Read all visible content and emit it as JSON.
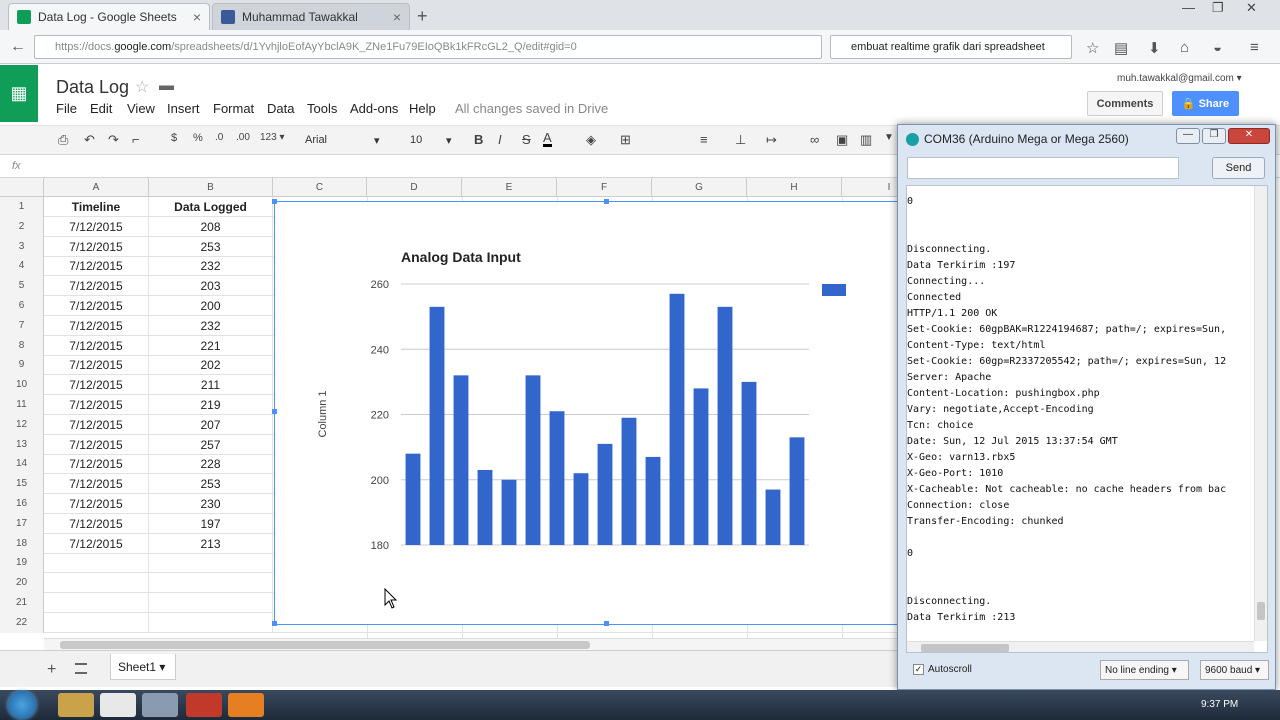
{
  "browser": {
    "tabs": [
      {
        "title": "Data Log - Google Sheets",
        "active": true,
        "favicon_color": "#0f9d58"
      },
      {
        "title": "Muhammad Tawakkal",
        "active": false,
        "favicon_color": "#3b5998"
      }
    ],
    "new_tab_label": "+",
    "url_prefix": "https://docs.",
    "url_host": "google.com",
    "url_path": "/spreadsheets/d/1YvhjloEofAyYbclA9K_ZNe1Fu79EIoQBk1kFRcGL2_Q/edit#gid=0",
    "search_text": "embuat realtime grafik dari spreadsheet",
    "win_minimize": "—",
    "win_restore": "❐",
    "win_close": "✕"
  },
  "sheets": {
    "doc_title": "Data Log",
    "star_icon": "☆",
    "folder_icon": "▬",
    "menu": [
      "File",
      "Edit",
      "View",
      "Insert",
      "Format",
      "Data",
      "Tools",
      "Add-ons",
      "Help"
    ],
    "save_status": "All changes saved in Drive",
    "user_email": "muh.tawakkal@gmail.com ▾",
    "comments_label": "Comments",
    "share_label": "🔒 Share",
    "fx_label": "fx",
    "toolbar": {
      "print": "⎙",
      "undo": "↶",
      "redo": "↷",
      "paint_format": "⌐",
      "currency": "$",
      "percent": "%",
      "dec_decrease": ".0",
      "dec_increase": ".00",
      "more_formats": "123 ▾",
      "font": "Arial",
      "font_arrow": "▾",
      "font_size": "10",
      "size_arrow": "▾",
      "bold": "B",
      "italic": "I",
      "strike": "S",
      "text_color": "A",
      "fill_color": "◈",
      "borders": "⊞",
      "align": "≡",
      "valign": "⊥",
      "wrap": "↦",
      "link": "∞",
      "comment": "▣",
      "chart": "▥",
      "filter": "▼"
    }
  },
  "grid": {
    "columns": [
      "A",
      "B",
      "C",
      "D",
      "E",
      "F",
      "G",
      "H",
      "I"
    ],
    "header_row": {
      "A": "Timeline",
      "B": "Data Logged"
    },
    "rows": [
      {
        "A": "7/12/2015",
        "B": "208"
      },
      {
        "A": "7/12/2015",
        "B": "253"
      },
      {
        "A": "7/12/2015",
        "B": "232"
      },
      {
        "A": "7/12/2015",
        "B": "203"
      },
      {
        "A": "7/12/2015",
        "B": "200"
      },
      {
        "A": "7/12/2015",
        "B": "232"
      },
      {
        "A": "7/12/2015",
        "B": "221"
      },
      {
        "A": "7/12/2015",
        "B": "202"
      },
      {
        "A": "7/12/2015",
        "B": "211"
      },
      {
        "A": "7/12/2015",
        "B": "219"
      },
      {
        "A": "7/12/2015",
        "B": "207"
      },
      {
        "A": "7/12/2015",
        "B": "257"
      },
      {
        "A": "7/12/2015",
        "B": "228"
      },
      {
        "A": "7/12/2015",
        "B": "253"
      },
      {
        "A": "7/12/2015",
        "B": "230"
      },
      {
        "A": "7/12/2015",
        "B": "197"
      },
      {
        "A": "7/12/2015",
        "B": "213"
      }
    ],
    "row_numbers": [
      "1",
      "2",
      "3",
      "4",
      "5",
      "6",
      "7",
      "8",
      "9",
      "10",
      "11",
      "12",
      "13",
      "14",
      "15",
      "16",
      "17",
      "18",
      "19",
      "20",
      "21",
      "22"
    ]
  },
  "chart_data": {
    "type": "bar",
    "title": "Analog Data Input",
    "ylabel": "Column 1",
    "xlabel": "",
    "values": [
      208,
      253,
      232,
      203,
      200,
      232,
      221,
      202,
      211,
      219,
      207,
      257,
      228,
      253,
      230,
      197,
      213
    ],
    "ylim": [
      180,
      260
    ],
    "yticks": [
      180,
      200,
      220,
      240,
      260
    ],
    "bar_color": "#3366cc",
    "grid": true,
    "legend": "top-right"
  },
  "sheet_tabs": {
    "add_label": "+",
    "active_tab": "Sheet1 ▾"
  },
  "serial": {
    "title": "COM36 (Arduino Mega or Mega 2560)",
    "send_label": "Send",
    "output_lines": [
      "0",
      "",
      "",
      "Disconnecting.",
      "Data Terkirim :197",
      "Connecting...",
      "Connected",
      "HTTP/1.1 200 OK",
      "Set-Cookie: 60gpBAK=R1224194687; path=/; expires=Sun,",
      "Content-Type: text/html",
      "Set-Cookie: 60gp=R2337205542; path=/; expires=Sun, 12",
      "Server: Apache",
      "Content-Location: pushingbox.php",
      "Vary: negotiate,Accept-Encoding",
      "Tcn: choice",
      "Date: Sun, 12 Jul 2015 13:37:54 GMT",
      "X-Geo: varn13.rbx5",
      "X-Geo-Port: 1010",
      "X-Cacheable: Not cacheable: no cache headers from bac",
      "Connection: close",
      "Transfer-Encoding: chunked",
      "",
      "0",
      "",
      "",
      "Disconnecting.",
      "Data Terkirim :213"
    ],
    "autoscroll_checked": "✓",
    "autoscroll_label": "Autoscroll",
    "line_ending": "No line ending ▾",
    "baud": "9600 baud ▾"
  },
  "taskbar": {
    "time": "9:37 PM"
  }
}
